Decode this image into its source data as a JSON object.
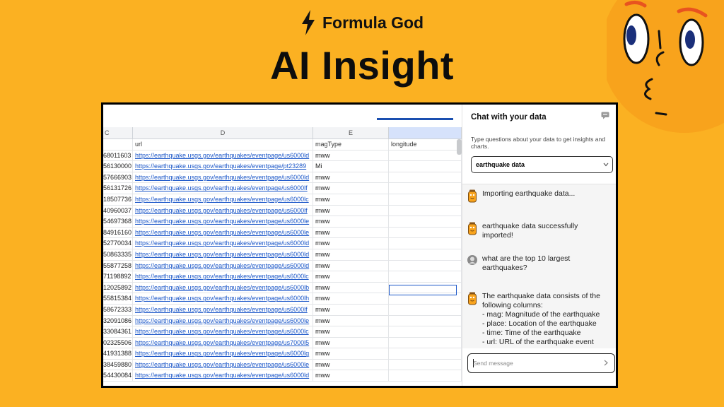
{
  "header": {
    "brand": "Formula God",
    "headline": "AI Insight"
  },
  "colors": {
    "background": "#FBB122",
    "link": "#1a56c8",
    "selection": "#d6e2fb"
  },
  "sheet": {
    "columns": [
      "C",
      "D",
      "E",
      ""
    ],
    "header_row": {
      "c": "",
      "d": "url",
      "e": "magType",
      "f": "longitude"
    },
    "rows": [
      {
        "id": "68011603",
        "url": "https://earthquake.usgs.gov/earthquakes/eventpage/us6000ld",
        "magType": "mww"
      },
      {
        "id": "56130000",
        "url": "https://earthquake.usgs.gov/earthquakes/eventpage/pt23289",
        "magType": "Mi"
      },
      {
        "id": "57666903",
        "url": "https://earthquake.usgs.gov/earthquakes/eventpage/us6000ld",
        "magType": "mww"
      },
      {
        "id": "56131726",
        "url": "https://earthquake.usgs.gov/earthquakes/eventpage/us6000lf",
        "magType": "mww"
      },
      {
        "id": "18507736",
        "url": "https://earthquake.usgs.gov/earthquakes/eventpage/us6000lc",
        "magType": "mww"
      },
      {
        "id": "40960037",
        "url": "https://earthquake.usgs.gov/earthquakes/eventpage/us6000lf",
        "magType": "mww"
      },
      {
        "id": "54697368",
        "url": "https://earthquake.usgs.gov/earthquakes/eventpage/us6000le",
        "magType": "mww"
      },
      {
        "id": "84916160",
        "url": "https://earthquake.usgs.gov/earthquakes/eventpage/us6000le",
        "magType": "mww"
      },
      {
        "id": "52770034",
        "url": "https://earthquake.usgs.gov/earthquakes/eventpage/us6000ld",
        "magType": "mww"
      },
      {
        "id": "50863335",
        "url": "https://earthquake.usgs.gov/earthquakes/eventpage/us6000ld",
        "magType": "mww"
      },
      {
        "id": "55877258",
        "url": "https://earthquake.usgs.gov/earthquakes/eventpage/us6000ld",
        "magType": "mww"
      },
      {
        "id": "71198892",
        "url": "https://earthquake.usgs.gov/earthquakes/eventpage/us6000lc",
        "magType": "mww"
      },
      {
        "id": "12025892",
        "url": "https://earthquake.usgs.gov/earthquakes/eventpage/us6000lb",
        "magType": "mww"
      },
      {
        "id": "55815384",
        "url": "https://earthquake.usgs.gov/earthquakes/eventpage/us6000lh",
        "magType": "mww"
      },
      {
        "id": "58672333",
        "url": "https://earthquake.usgs.gov/earthquakes/eventpage/us6000lf",
        "magType": "mww"
      },
      {
        "id": "32091086",
        "url": "https://earthquake.usgs.gov/earthquakes/eventpage/us6000le",
        "magType": "mww"
      },
      {
        "id": "33084361",
        "url": "https://earthquake.usgs.gov/earthquakes/eventpage/us6000lc",
        "magType": "mww"
      },
      {
        "id": "02325506",
        "url": "https://earthquake.usgs.gov/earthquakes/eventpage/us7000l5",
        "magType": "mww"
      },
      {
        "id": "41931388",
        "url": "https://earthquake.usgs.gov/earthquakes/eventpage/us6000lg",
        "magType": "mww"
      },
      {
        "id": "38459880",
        "url": "https://earthquake.usgs.gov/earthquakes/eventpage/us6000le",
        "magType": "mww"
      },
      {
        "id": "54430084",
        "url": "https://earthquake.usgs.gov/earthquakes/eventpage/us6000ld",
        "magType": "mww"
      }
    ]
  },
  "chat": {
    "title": "Chat with your data",
    "description": "Type questions about your data to get insights and charts.",
    "dataset": "earthquake data",
    "messages": [
      {
        "from": "bot",
        "lines": [
          "Importing earthquake data..."
        ]
      },
      {
        "from": "bot",
        "lines": [
          "earthquake data successfully",
          "imported!"
        ]
      },
      {
        "from": "user",
        "lines": [
          "what are the top 10 largest",
          "earthquakes?"
        ]
      },
      {
        "from": "bot",
        "lines": [
          "The earthquake data consists of the",
          "following columns:",
          "- mag: Magnitude of the earthquake",
          "- place: Location of the earthquake",
          "- time: Time of the earthquake",
          "- url: URL of the earthquake event"
        ]
      }
    ],
    "input_placeholder": "Send message"
  }
}
